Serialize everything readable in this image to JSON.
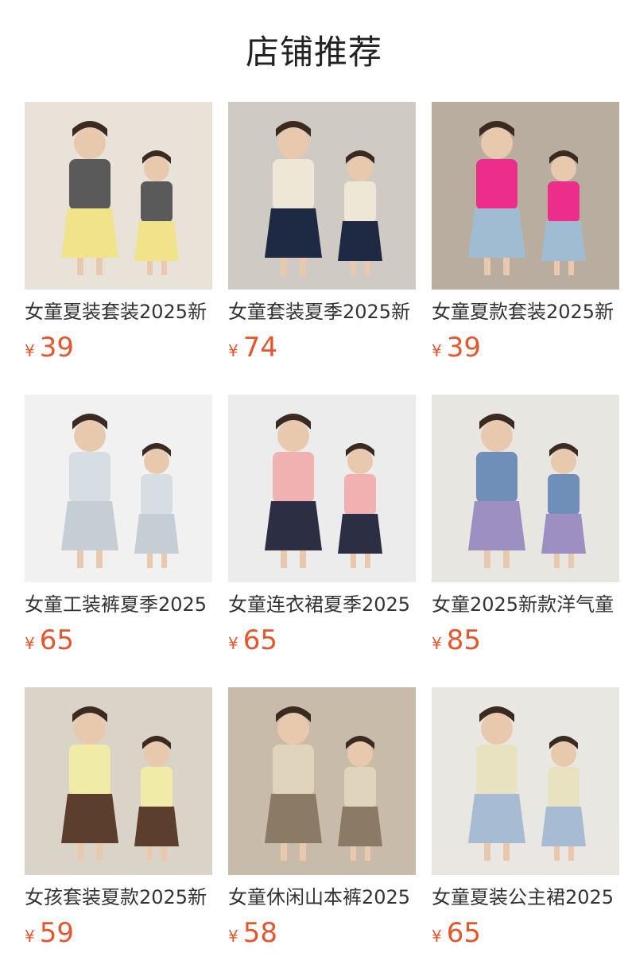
{
  "header": {
    "title": "店铺推荐"
  },
  "products": [
    {
      "name": "女童夏装套装2025新",
      "currency": "¥",
      "price": "39",
      "image_icon": "product-photo-icon",
      "colors": {
        "bg": "#e8e2d8",
        "main": "#5a5a5a",
        "accent": "#f0e38a"
      }
    },
    {
      "name": "女童套装夏季2025新",
      "currency": "¥",
      "price": "74",
      "image_icon": "product-photo-icon",
      "colors": {
        "bg": "#cfcac3",
        "main": "#efe7d6",
        "accent": "#1e2a44"
      }
    },
    {
      "name": "女童夏款套装2025新",
      "currency": "¥",
      "price": "39",
      "image_icon": "product-photo-icon",
      "colors": {
        "bg": "#b9ada0",
        "main": "#ec2e8a",
        "accent": "#9fbcd3"
      }
    },
    {
      "name": "女童工装裤夏季2025",
      "currency": "¥",
      "price": "65",
      "image_icon": "product-photo-icon",
      "colors": {
        "bg": "#f1f1f1",
        "main": "#d6dde3",
        "accent": "#c6ced5"
      }
    },
    {
      "name": "女童连衣裙夏季2025",
      "currency": "¥",
      "price": "65",
      "image_icon": "product-photo-icon",
      "colors": {
        "bg": "#ececec",
        "main": "#f1b1b1",
        "accent": "#2c2f44"
      }
    },
    {
      "name": "女童2025新款洋气童",
      "currency": "¥",
      "price": "85",
      "image_icon": "product-photo-icon",
      "colors": {
        "bg": "#e8e6e1",
        "main": "#6f8fb8",
        "accent": "#9d8fc2"
      }
    },
    {
      "name": "女孩套装夏款2025新",
      "currency": "¥",
      "price": "59",
      "image_icon": "product-photo-icon",
      "colors": {
        "bg": "#d9d3c8",
        "main": "#f1eba8",
        "accent": "#5b3e2c"
      }
    },
    {
      "name": "女童休闲山本裤2025",
      "currency": "¥",
      "price": "58",
      "image_icon": "product-photo-icon",
      "colors": {
        "bg": "#c8bba9",
        "main": "#e1d4bd",
        "accent": "#8a7a66"
      }
    },
    {
      "name": "女童夏装公主裙2025",
      "currency": "¥",
      "price": "65",
      "image_icon": "product-photo-icon",
      "colors": {
        "bg": "#e9e7e2",
        "main": "#e9e2c0",
        "accent": "#a7bcd3"
      }
    }
  ],
  "colors": {
    "price": "#e4572e",
    "title": "#222222",
    "name": "#333333"
  }
}
